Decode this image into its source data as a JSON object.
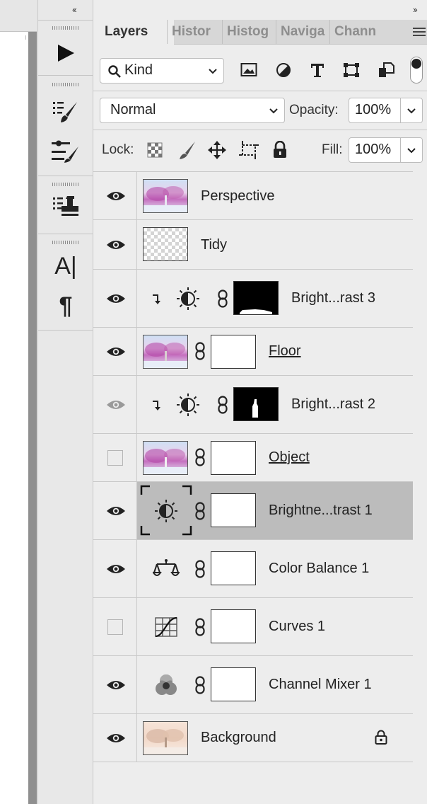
{
  "toolbar_collapse": "‹‹",
  "panel_collapse": "››",
  "tabs": [
    "Layers",
    "Histor",
    "Histog",
    "Naviga",
    "Chann"
  ],
  "filter": {
    "kind_label": "Kind"
  },
  "blend": {
    "mode": "Normal",
    "opacity_label": "Opacity:",
    "opacity_value": "100%"
  },
  "lock": {
    "label": "Lock:",
    "fill_label": "Fill:",
    "fill_value": "100%"
  },
  "tools": {
    "character_glyph": "A|",
    "paragraph_glyph": "¶"
  },
  "layers": [
    {
      "name": "Perspective",
      "visible": true
    },
    {
      "name": "Tidy",
      "visible": true
    },
    {
      "name": "Bright...rast 3",
      "visible": true
    },
    {
      "name": "Floor",
      "visible": true
    },
    {
      "name": "Bright...rast 2",
      "visible": true,
      "dim_eye": true
    },
    {
      "name": "Object",
      "visible": false
    },
    {
      "name": "Brightne...trast 1",
      "visible": true,
      "selected": true
    },
    {
      "name": "Color Balance 1",
      "visible": true
    },
    {
      "name": "Curves 1",
      "visible": false
    },
    {
      "name": "Channel Mixer 1",
      "visible": true
    },
    {
      "name": "Background",
      "visible": true,
      "locked": true
    }
  ],
  "colors": {
    "selected_row": "#bcbcbc",
    "panel_bg": "#ededed",
    "tab_bar": "#d7d7d7"
  }
}
